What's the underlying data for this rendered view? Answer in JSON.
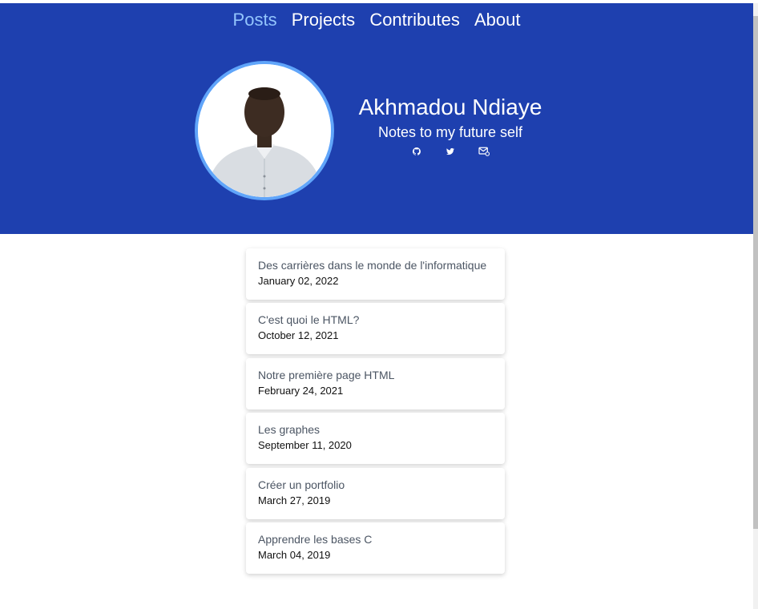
{
  "nav": {
    "items": [
      {
        "label": "Posts"
      },
      {
        "label": "Projects"
      },
      {
        "label": "Contributes"
      },
      {
        "label": "About"
      }
    ]
  },
  "profile": {
    "name": "Akhmadou Ndiaye",
    "tagline": "Notes to my future self",
    "social": [
      {
        "icon": "github-icon"
      },
      {
        "icon": "twitter-icon"
      },
      {
        "icon": "mail-icon"
      }
    ]
  },
  "posts": [
    {
      "title": "Des carrières dans le monde de l'informatique",
      "date": "January 02, 2022"
    },
    {
      "title": "C'est quoi le HTML?",
      "date": "October 12, 2021"
    },
    {
      "title": "Notre première page HTML",
      "date": "February 24, 2021"
    },
    {
      "title": "Les graphes",
      "date": "September 11, 2020"
    },
    {
      "title": "Créer un portfolio",
      "date": "March 27, 2019"
    },
    {
      "title": "Apprendre les bases C",
      "date": "March 04, 2019"
    }
  ],
  "colors": {
    "header_bg": "#1e40af",
    "nav_active": "#93c5fd",
    "avatar_ring": "#60a5fa"
  }
}
